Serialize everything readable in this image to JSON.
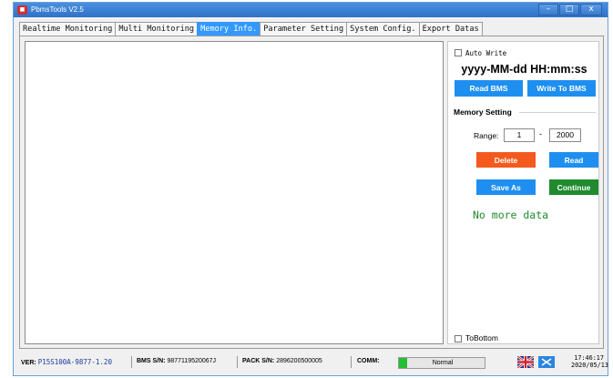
{
  "window": {
    "title": "PbmsTools V2.5",
    "controls": {
      "minimize": "–",
      "maximize": "□",
      "close": "x"
    }
  },
  "tabs": [
    {
      "label": "Realtime Monitoring",
      "active": false
    },
    {
      "label": "Multi Monitoring",
      "active": false
    },
    {
      "label": "Memory Info.",
      "active": true
    },
    {
      "label": "Parameter Setting",
      "active": false
    },
    {
      "label": "System Config.",
      "active": false
    },
    {
      "label": "Export Datas",
      "active": false
    }
  ],
  "right_panel": {
    "auto_write_label": "Auto Write",
    "datetime_format": "yyyy-MM-dd HH:mm:ss",
    "read_bms_button": "Read BMS",
    "write_to_bms_button": "Write To BMS",
    "memory_setting_title": "Memory Setting",
    "range_label": "Range:",
    "range_from": "1",
    "range_separator": "-",
    "range_to": "2000",
    "delete_button": "Delete",
    "read_button": "Read",
    "save_as_button": "Save As",
    "continue_button": "Continue",
    "status_message": "No more data",
    "to_bottom_label": "ToBottom"
  },
  "status_bar": {
    "ver_label": "VER:",
    "ver_value": "P15S100A-9877-1.20",
    "bms_sn_label": "BMS S/N:",
    "bms_sn_value": "9877119520067J",
    "pack_sn_label": "PACK S/N:",
    "pack_sn_value": "2896200500005",
    "comm_label": "COMM:",
    "comm_status": "Normal",
    "comm_progress": 0.1,
    "time": "17:46:17",
    "date": "2020/05/13"
  },
  "colors": {
    "accent_blue": "#1e8ff0",
    "delete_orange": "#f45a1e",
    "continue_green": "#1f8a2e",
    "active_tab": "#3399ff",
    "status_text_green": "#1f8a2e",
    "comm_fill": "#22c032"
  },
  "icons": {
    "language_flag": "uk-flag-icon",
    "connection": "connection-icon"
  }
}
